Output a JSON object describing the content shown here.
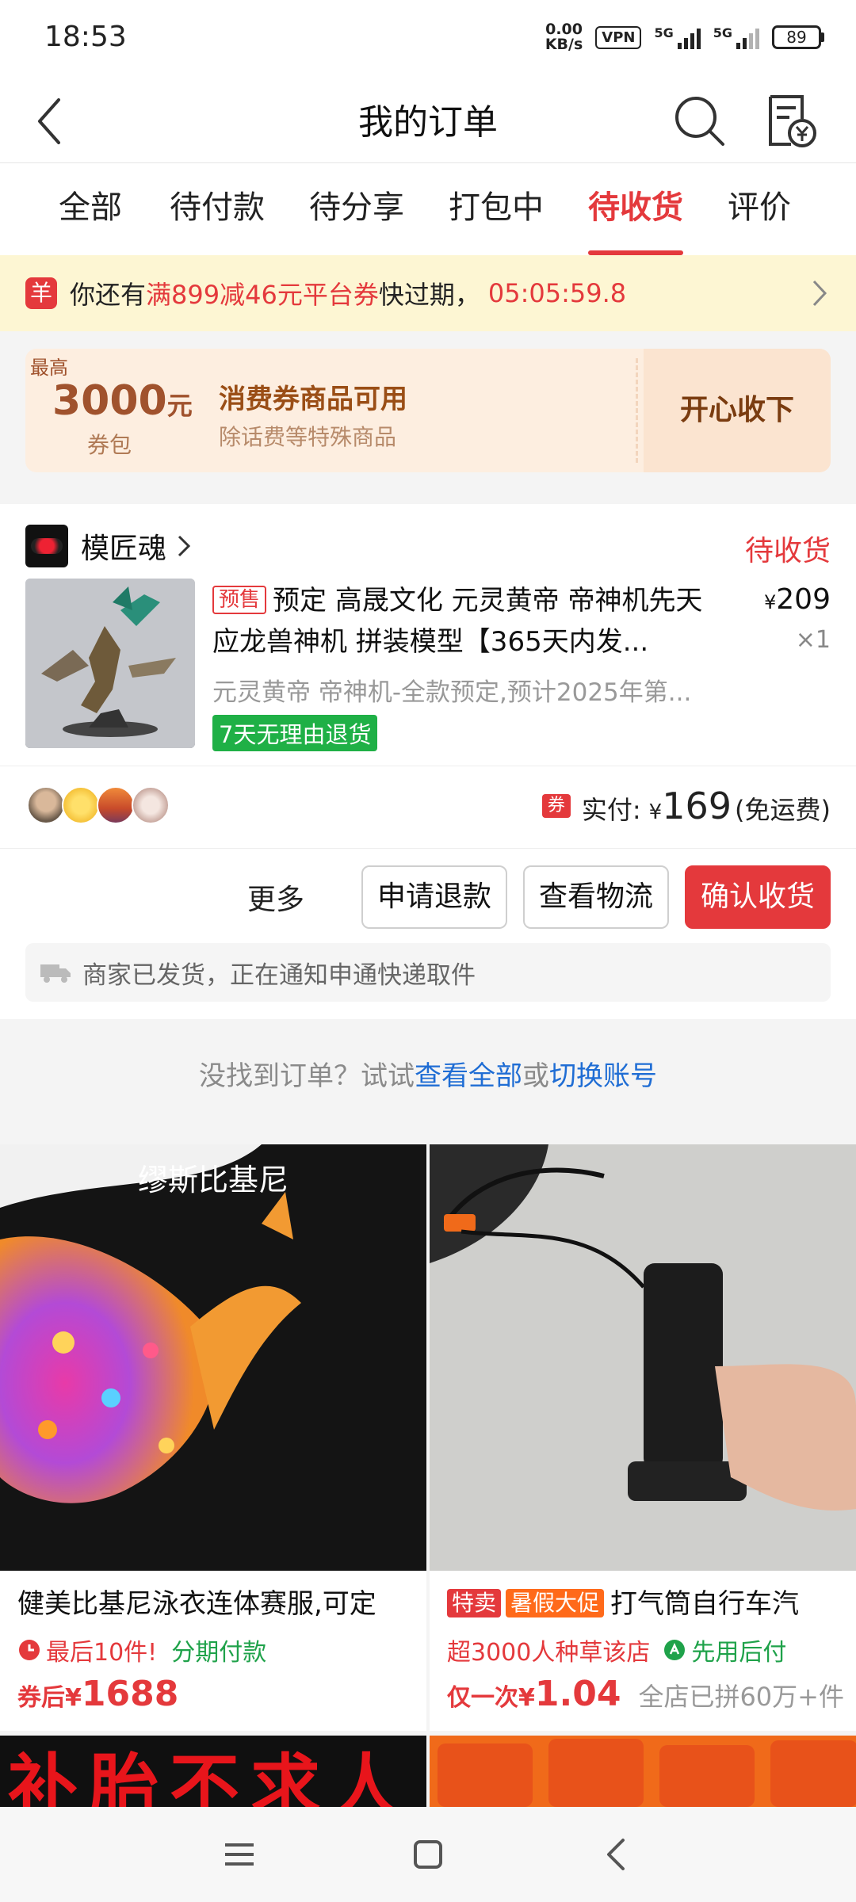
{
  "status_bar": {
    "time": "18:53",
    "net_speed_top": "0.00",
    "net_speed_bottom": "KB/s",
    "vpn": "VPN",
    "signal1": "5G",
    "signal2": "5G",
    "battery": "89"
  },
  "header": {
    "title": "我的订单"
  },
  "tabs": [
    {
      "label": "全部",
      "active": false
    },
    {
      "label": "待付款",
      "active": false
    },
    {
      "label": "待分享",
      "active": false
    },
    {
      "label": "打包中",
      "active": false
    },
    {
      "label": "待收货",
      "active": true
    },
    {
      "label": "评价",
      "active": false
    }
  ],
  "coupon_banner": {
    "icon_text": "羊",
    "prefix": "你还有",
    "highlight": "满899减46元平台券",
    "suffix": "快过期，",
    "timer": "05:05:59.8"
  },
  "voucher": {
    "tag": "最高",
    "amount": "3000",
    "unit": "元",
    "pack": "券包",
    "title": "消费券商品可用",
    "subtitle": "除话费等特殊商品",
    "button": "开心收下"
  },
  "order": {
    "shop_name": "模匠魂",
    "status": "待收货",
    "presale_tag": "预售",
    "product_title": "预定 高晟文化 元灵黄帝 帝神机先天应龙兽神机 拼装模型【365天内发...",
    "price_symbol": "¥",
    "price": "209",
    "quantity": "×1",
    "spec": "元灵黄帝 帝神机-全款预定,预计2025年第...",
    "return_badge": "7天无理由退货",
    "pay_icon": "券",
    "pay_label": "实付:",
    "pay_symbol": "¥",
    "pay_amount": "169",
    "pay_note": "(免运费)",
    "actions": {
      "more": "更多",
      "refund": "申请退款",
      "logistics": "查看物流",
      "confirm": "确认收货"
    },
    "shipping_note": "商家已发货，正在通知申通快递取件"
  },
  "hint": {
    "prefix": "没找到订单？试试",
    "link1": "查看全部",
    "middle": "或",
    "link2": "切换账号"
  },
  "recommendations": [
    {
      "overlay": "缪斯比基尼",
      "title": "健美比基尼泳衣连体赛服,可定",
      "meta1": "最后10件!",
      "meta2": "分期付款",
      "price_prefix": "券后¥",
      "price": "1688"
    },
    {
      "tag1": "特卖",
      "tag2": "暑假大促",
      "title": "打气筒自行车汽",
      "meta1": "超3000人种草该店",
      "meta2": "先用后付",
      "price_prefix": "仅一次¥",
      "price": "1.04",
      "sold": "全店已拼60万+件"
    }
  ],
  "bottom_banners": {
    "left_text": "补胎不求人"
  },
  "colors": {
    "accent": "#e4393c",
    "green": "#1fb046",
    "link": "#1f6dd4"
  }
}
